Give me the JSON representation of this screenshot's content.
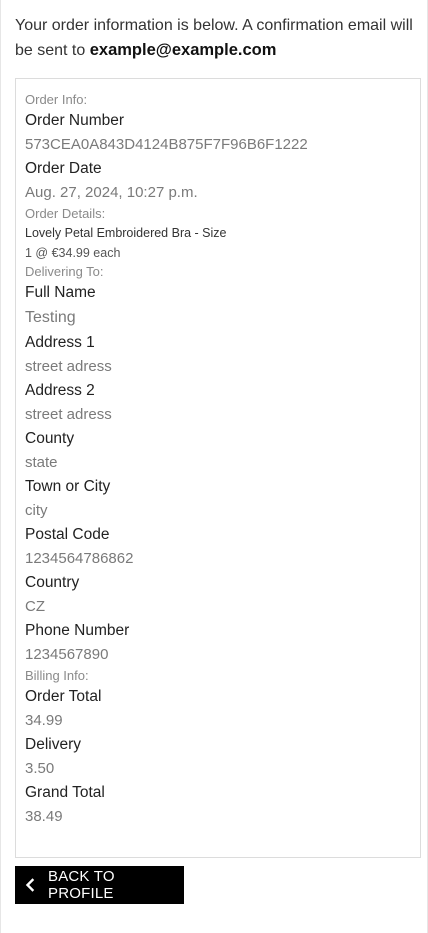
{
  "intro": {
    "text": "Your order information is below. A confirmation email will be sent to ",
    "email": "example@example.com"
  },
  "order_info": {
    "section_label": "Order Info:",
    "order_number_label": "Order Number",
    "order_number": "573CEA0A843D4124B875F7F96B6F1222",
    "order_date_label": "Order Date",
    "order_date": "Aug. 27, 2024, 10:27 p.m."
  },
  "order_details": {
    "section_label": "Order Details:",
    "items": [
      {
        "name": "Lovely Petal Embroidered Bra - Size",
        "quantity_price": "1 @ €34.99 each"
      }
    ]
  },
  "delivering_to": {
    "section_label": "Delivering To:",
    "full_name_label": "Full Name",
    "full_name": "Testing",
    "address1_label": "Address 1",
    "address1": "street adress",
    "address2_label": "Address 2",
    "address2": "street adress",
    "county_label": "County",
    "county": "state",
    "town_label": "Town or City",
    "town": "city",
    "postal_label": "Postal Code",
    "postal": "1234564786862",
    "country_label": "Country",
    "country": "CZ",
    "phone_label": "Phone Number",
    "phone": "1234567890"
  },
  "billing_info": {
    "section_label": "Billing Info:",
    "order_total_label": "Order Total",
    "order_total": "34.99",
    "delivery_label": "Delivery",
    "delivery": "3.50",
    "grand_total_label": "Grand Total",
    "grand_total": "38.49"
  },
  "actions": {
    "back_label": "BACK TO PROFILE",
    "back_icon": "chevron-left-icon"
  },
  "colors": {
    "button_bg": "#000000",
    "button_text": "#ffffff",
    "muted_text": "#7a7a7a",
    "border": "#dcdcdc"
  }
}
